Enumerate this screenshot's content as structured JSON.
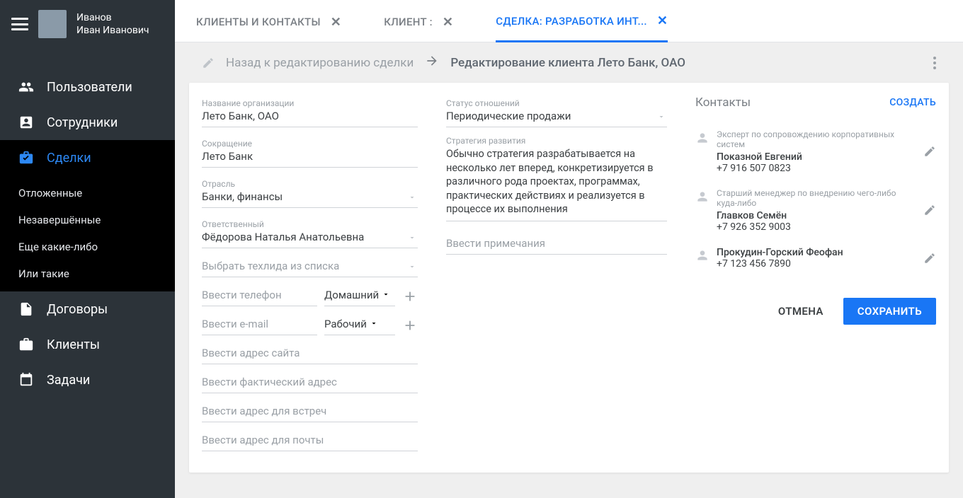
{
  "user": {
    "name_line1": "Иванов",
    "name_line2": "Иван Иванович"
  },
  "sidebar": {
    "items": [
      {
        "label": "Пользователи"
      },
      {
        "label": "Сотрудники"
      },
      {
        "label": "Сделки"
      },
      {
        "label": "Договоры"
      },
      {
        "label": "Клиенты"
      },
      {
        "label": "Задачи"
      }
    ],
    "sub_items": [
      {
        "label": "Отложенные"
      },
      {
        "label": "Незавершённые"
      },
      {
        "label": "Еще какие-либо"
      },
      {
        "label": "Или такие"
      }
    ]
  },
  "tabs": [
    {
      "label": "КЛИЕНТЫ И КОНТАКТЫ"
    },
    {
      "label": "КЛИЕНТ :"
    },
    {
      "label": "СДЕЛКА: РАЗРАБОТКА ИНТ..."
    }
  ],
  "breadcrumb": {
    "back": "Назад к редактированию сделки",
    "current": "Редактирование клиента Лето Банк, ОАО"
  },
  "form": {
    "org_label": "Название организации",
    "org_value": "Лето Банк, ОАО",
    "short_label": "Сокращение",
    "short_value": "Лето Банк",
    "industry_label": "Отрасль",
    "industry_value": "Банки, финансы",
    "responsible_label": "Ответственный",
    "responsible_value": "Фёдорова Наталья Анатольевна",
    "techlead_placeholder": "Выбрать техлида из списка",
    "phone_placeholder": "Ввести телефон",
    "phone_type": "Домашний",
    "email_placeholder": "Ввести e-mail",
    "email_type": "Рабочий",
    "site_placeholder": "Ввести адрес сайта",
    "addr_fact_placeholder": "Ввести фактический адрес",
    "addr_meet_placeholder": "Ввести адрес для встреч",
    "addr_mail_placeholder": "Ввести адрес для почты",
    "status_label": "Статус отношений",
    "status_value": "Периодические продажи",
    "strategy_label": "Стратегия развития",
    "strategy_text": "Обычно стратегия разрабатывается на несколько лет вперед, конкретизируется в различного рода проектах, программах, практических действиях и реализуется в процессе их выполнения",
    "notes_placeholder": "Ввести примечания"
  },
  "contacts": {
    "title": "Контакты",
    "create": "СОЗДАТЬ",
    "list": [
      {
        "role": "Эксперт по сопровождению корпоративных систем",
        "name": "Показной Евгений",
        "phone": "+7 916 507 0823"
      },
      {
        "role": "Старший менеджер по внедрению чего-либо куда-либо",
        "name": "Главков Семён",
        "phone": "+7 926 352 9003"
      },
      {
        "role": "",
        "name": "Прокудин-Горский Феофан",
        "phone": "+7 123 456 7890"
      }
    ]
  },
  "actions": {
    "cancel": "ОТМЕНА",
    "save": "СОХРАНИТЬ"
  }
}
